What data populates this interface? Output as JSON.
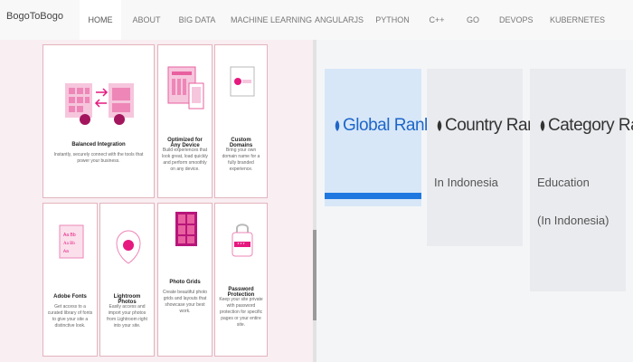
{
  "brand": "BogoToBogo",
  "nav": {
    "items": [
      "HOME",
      "ABOUT",
      "BIG DATA",
      "MACHINE LEARNING",
      "ANGULARJS",
      "PYTHON",
      "C++",
      "GO",
      "DEVOPS",
      "KUBERNETES"
    ],
    "active": "HOME"
  },
  "features": {
    "cards": [
      {
        "title": "Balanced Integration",
        "desc": "Instantly, securely connect with the tools that power your business."
      },
      {
        "title": "Optimized for Any Device",
        "desc": "Build experiences that look great, load quickly and perform smoothly on any device."
      },
      {
        "title": "Custom Domains",
        "desc": "Bring your own domain name for a fully branded experience."
      },
      {
        "title": "Adobe Fonts",
        "desc": "Get access to a curated library of fonts to give your site a distinctive look."
      },
      {
        "title": "Lightroom Photos",
        "desc": "Easily access and import your photos from Lightroom right into your site."
      },
      {
        "title": "Photo Grids",
        "desc": "Create beautiful photo grids and layouts that showcase your best work."
      },
      {
        "title": "Password Protection",
        "desc": "Keep your site private with password protection for specific pages or your entire site."
      }
    ]
  },
  "rank": {
    "active": "Global Rank",
    "cards": [
      {
        "title": "Global Rank",
        "sub1": "",
        "sub2": ""
      },
      {
        "title": "Country Rank",
        "sub1": "In Indonesia",
        "sub2": ""
      },
      {
        "title": "Category Rank",
        "sub1": "Education",
        "sub2": "(In Indonesia)"
      }
    ]
  },
  "colors": {
    "accent": "#e6197f",
    "rank_blue": "#1f78e0",
    "panel_pink": "#f9eef1"
  },
  "icons": {
    "rank": "chart-icon"
  }
}
